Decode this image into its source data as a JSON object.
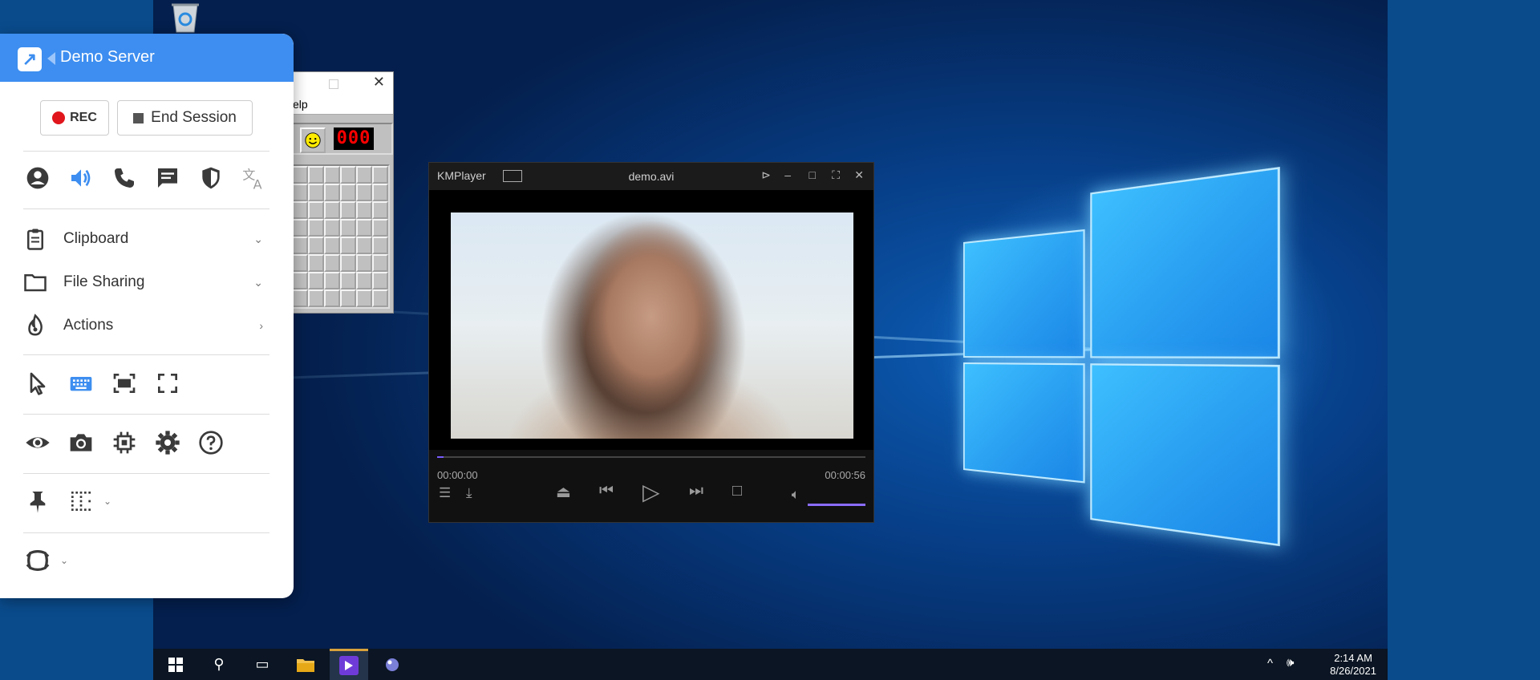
{
  "panel": {
    "server_name": "Demo Server",
    "rec_label": "REC",
    "end_session_label": "End Session",
    "menu": [
      {
        "label": "Clipboard",
        "chevron": "⌄"
      },
      {
        "label": "File Sharing",
        "chevron": "⌄"
      },
      {
        "label": "Actions",
        "chevron": "›"
      }
    ],
    "colors": {
      "accent": "#3d8ef0",
      "rec": "#e0161c",
      "icon": "#3a3a3a"
    }
  },
  "minesweeper": {
    "menu_text": "elp",
    "counter": "000"
  },
  "kmplayer": {
    "brand": "KMPlayer",
    "filename": "demo.avi",
    "time_elapsed": "00:00:00",
    "time_total": "00:00:56",
    "seek_progress": 0.015,
    "volume_level": 1.0
  },
  "taskbar": {
    "time": "2:14 AM",
    "date": "8/26/2021"
  }
}
